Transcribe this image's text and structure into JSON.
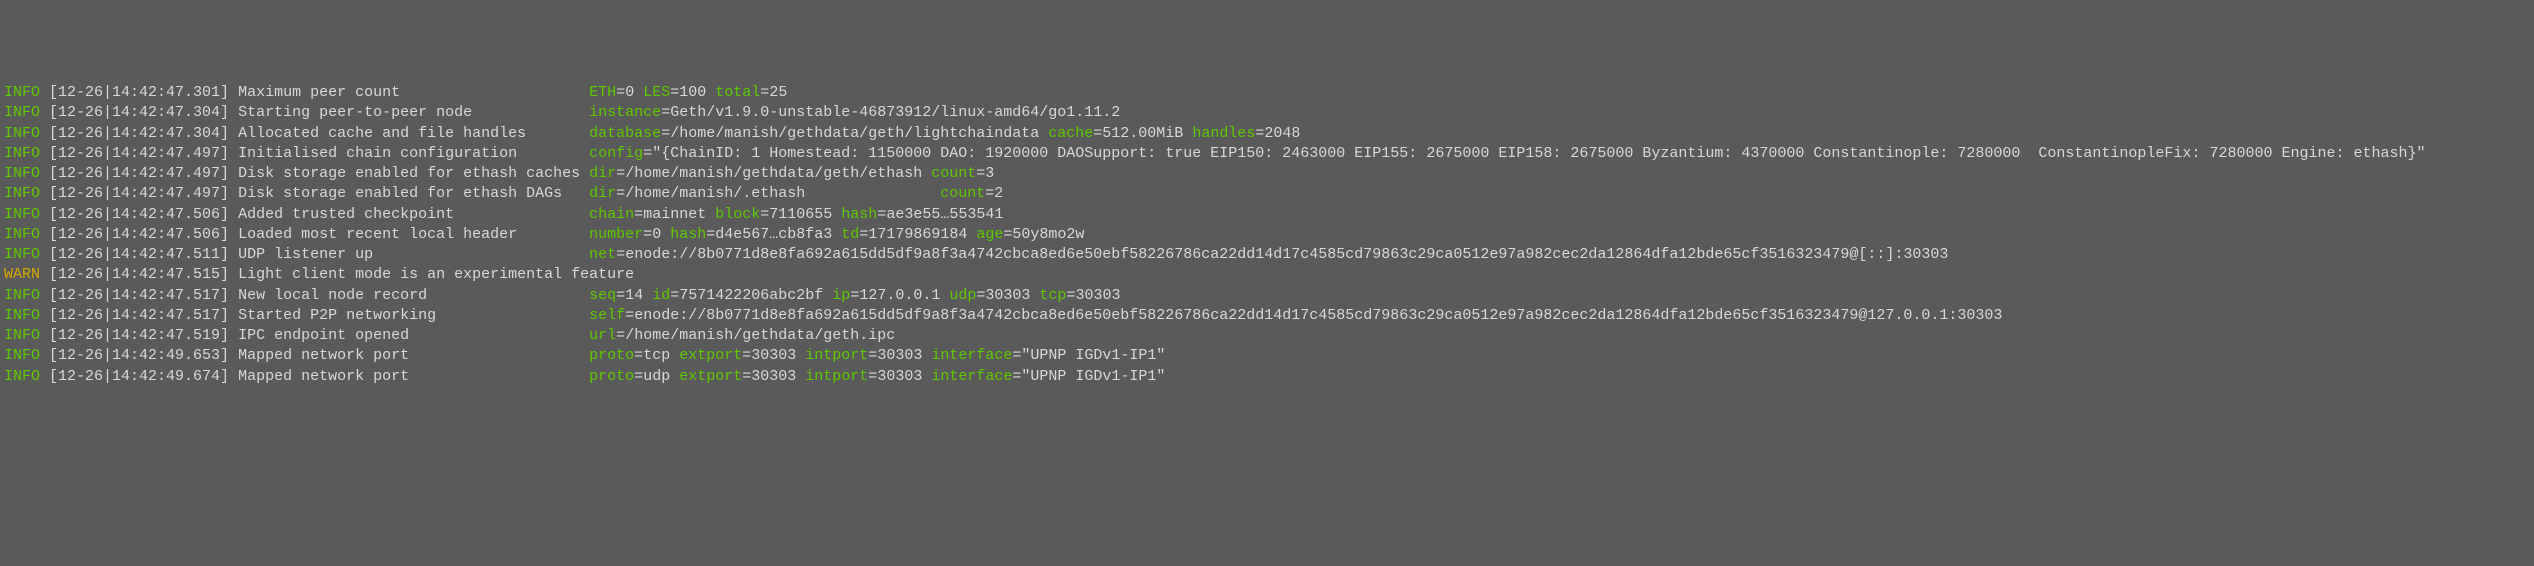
{
  "lines": [
    {
      "level": "INFO",
      "ts": "[12-26|14:42:47.301]",
      "msg": "Maximum peer count",
      "msgPad": 38,
      "kv": [
        {
          "k": "ETH",
          "v": "0"
        },
        {
          "k": "LES",
          "v": "100"
        },
        {
          "k": "total",
          "v": "25"
        }
      ]
    },
    {
      "level": "INFO",
      "ts": "[12-26|14:42:47.304]",
      "msg": "Starting peer-to-peer node",
      "msgPad": 38,
      "kv": [
        {
          "k": "instance",
          "v": "Geth/v1.9.0-unstable-46873912/linux-amd64/go1.11.2"
        }
      ]
    },
    {
      "level": "INFO",
      "ts": "[12-26|14:42:47.304]",
      "msg": "Allocated cache and file handles",
      "msgPad": 38,
      "kv": [
        {
          "k": "database",
          "v": "/home/manish/gethdata/geth/lightchaindata"
        },
        {
          "k": "cache",
          "v": "512.00MiB"
        },
        {
          "k": "handles",
          "v": "2048"
        }
      ]
    },
    {
      "level": "INFO",
      "ts": "[12-26|14:42:47.497]",
      "msg": "Initialised chain configuration",
      "msgPad": 38,
      "kv": [
        {
          "k": "config",
          "v": "\"{ChainID: 1 Homestead: 1150000 DAO: 1920000 DAOSupport: true EIP150: 2463000 EIP155: 2675000 EIP158: 2675000 Byzantium: 4370000 Constantinople: 7280000  ConstantinopleFix: 7280000 Engine: ethash}\""
        }
      ]
    },
    {
      "level": "INFO",
      "ts": "[12-26|14:42:47.497]",
      "msg": "Disk storage enabled for ethash caches",
      "msgPad": 38,
      "kv": [
        {
          "k": "dir",
          "v": "/home/manish/gethdata/geth/ethash"
        },
        {
          "k": "count",
          "v": "3"
        }
      ]
    },
    {
      "level": "INFO",
      "ts": "[12-26|14:42:47.497]",
      "msg": "Disk storage enabled for ethash DAGs",
      "msgPad": 38,
      "kv": [
        {
          "k": "dir",
          "v": "/home/manish/.ethash",
          "pad": 34
        },
        {
          "k": "count",
          "v": "2"
        }
      ]
    },
    {
      "level": "INFO",
      "ts": "[12-26|14:42:47.506]",
      "msg": "Added trusted checkpoint",
      "msgPad": 38,
      "kv": [
        {
          "k": "chain",
          "v": "mainnet"
        },
        {
          "k": "block",
          "v": "7110655"
        },
        {
          "k": "hash",
          "v": "ae3e55…553541"
        }
      ]
    },
    {
      "level": "INFO",
      "ts": "[12-26|14:42:47.506]",
      "msg": "Loaded most recent local header",
      "msgPad": 38,
      "kv": [
        {
          "k": "number",
          "v": "0"
        },
        {
          "k": "hash",
          "v": "d4e567…cb8fa3"
        },
        {
          "k": "td",
          "v": "17179869184"
        },
        {
          "k": "age",
          "v": "50y8mo2w"
        }
      ]
    },
    {
      "level": "INFO",
      "ts": "[12-26|14:42:47.511]",
      "msg": "UDP listener up",
      "msgPad": 38,
      "kv": [
        {
          "k": "net",
          "v": "enode://8b0771d8e8fa692a615dd5df9a8f3a4742cbca8ed6e50ebf58226786ca22dd14d17c4585cd79863c29ca0512e97a982cec2da12864dfa12bde65cf3516323479@[::]:30303"
        }
      ]
    },
    {
      "level": "WARN",
      "ts": "[12-26|14:42:47.515]",
      "msg": "Light client mode is an experimental feature",
      "msgPad": 0,
      "kv": []
    },
    {
      "level": "INFO",
      "ts": "[12-26|14:42:47.517]",
      "msg": "New local node record",
      "msgPad": 38,
      "kv": [
        {
          "k": "seq",
          "v": "14"
        },
        {
          "k": "id",
          "v": "7571422206abc2bf"
        },
        {
          "k": "ip",
          "v": "127.0.0.1"
        },
        {
          "k": "udp",
          "v": "30303"
        },
        {
          "k": "tcp",
          "v": "30303"
        }
      ]
    },
    {
      "level": "INFO",
      "ts": "[12-26|14:42:47.517]",
      "msg": "Started P2P networking",
      "msgPad": 38,
      "kv": [
        {
          "k": "self",
          "v": "enode://8b0771d8e8fa692a615dd5df9a8f3a4742cbca8ed6e50ebf58226786ca22dd14d17c4585cd79863c29ca0512e97a982cec2da12864dfa12bde65cf3516323479@127.0.0.1:30303"
        }
      ]
    },
    {
      "level": "INFO",
      "ts": "[12-26|14:42:47.519]",
      "msg": "IPC endpoint opened",
      "msgPad": 38,
      "kv": [
        {
          "k": "url",
          "v": "/home/manish/gethdata/geth.ipc"
        }
      ]
    },
    {
      "level": "INFO",
      "ts": "[12-26|14:42:49.653]",
      "msg": "Mapped network port",
      "msgPad": 38,
      "kv": [
        {
          "k": "proto",
          "v": "tcp"
        },
        {
          "k": "extport",
          "v": "30303"
        },
        {
          "k": "intport",
          "v": "30303"
        },
        {
          "k": "interface",
          "v": "\"UPNP IGDv1-IP1\""
        }
      ]
    },
    {
      "level": "INFO",
      "ts": "[12-26|14:42:49.674]",
      "msg": "Mapped network port",
      "msgPad": 38,
      "kv": [
        {
          "k": "proto",
          "v": "udp"
        },
        {
          "k": "extport",
          "v": "30303"
        },
        {
          "k": "intport",
          "v": "30303"
        },
        {
          "k": "interface",
          "v": "\"UPNP IGDv1-IP1\""
        }
      ]
    }
  ]
}
